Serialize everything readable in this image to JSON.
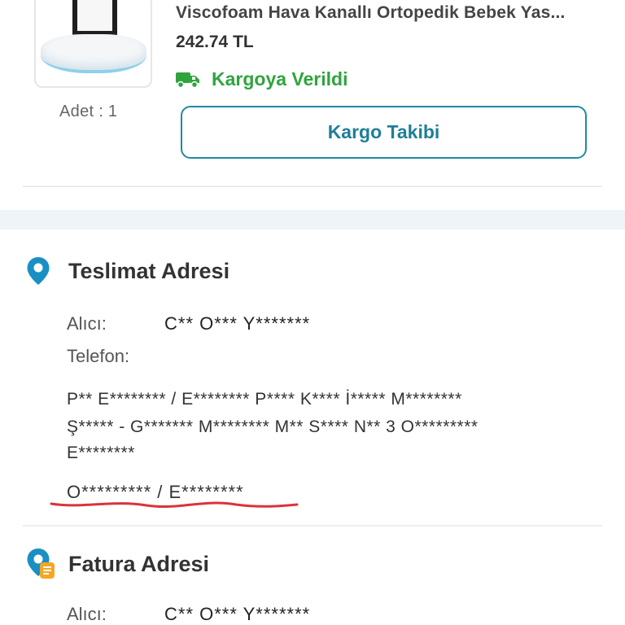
{
  "order_item": {
    "product_name": "Viscofoam Hava Kanallı Ortopedik Bebek Yas...",
    "price": "242.74 TL",
    "status": "Kargoya Verildi",
    "quantity": "Adet : 1",
    "track_button_label": "Kargo Takibi"
  },
  "delivery_address": {
    "title": "Teslimat Adresi",
    "recipient_label": "Alıcı:",
    "recipient_value": "C** O*** Y*******",
    "phone_label": "Telefon:",
    "address_lines": [
      "P** E******** / E******** P**** K**** İ*****  M********",
      "Ş***** - G******* M******** M** S**** N** 3 O*********",
      "E********"
    ],
    "city": "O********* / E********"
  },
  "billing_address": {
    "title": "Fatura Adresi",
    "recipient_label": "Alıcı:",
    "recipient_value": "C** O*** Y*******"
  },
  "colors": {
    "accent": "#1e8aa2",
    "status_green": "#2fa43e",
    "annotation_red": "#d9343a",
    "pin_blue": "#1a8fc4",
    "billing_badge": "#f5a623"
  },
  "icons": {
    "status": "truck-icon",
    "delivery": "location-pin-icon",
    "billing": "location-pin-invoice-icon"
  }
}
